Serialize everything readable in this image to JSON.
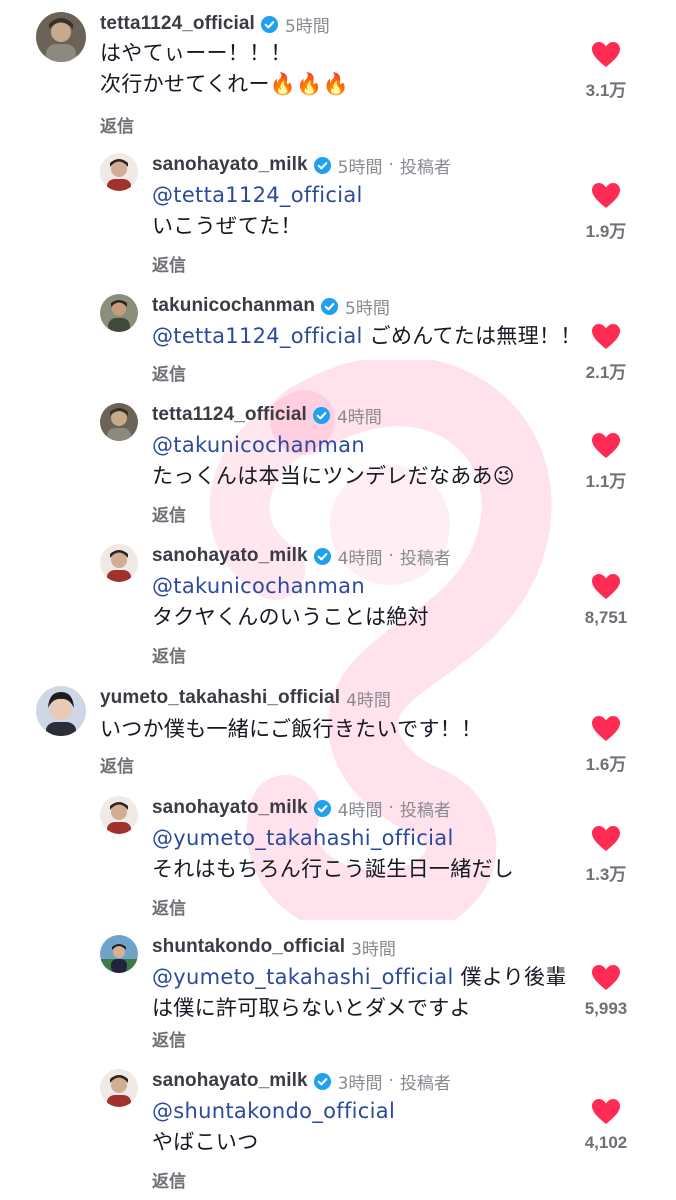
{
  "colors": {
    "mention": "#2b4a9e",
    "heart": "#fe2c55",
    "verified": "#20a0f0",
    "watermark": "#ff7aa8"
  },
  "icons": {
    "verified": "verified-badge-icon",
    "like": "heart-icon",
    "watermark": "app-logo-watermark"
  },
  "comments": [
    {
      "username": "tetta1124_official",
      "time": "5時間",
      "author": "",
      "mention": "",
      "line1": "はやてぃーー！！！",
      "line2": "次行かせてくれー🔥🔥🔥",
      "reply": "返信",
      "likes": "3.1万"
    },
    {
      "username": "sanohayato_milk",
      "time": "5時間",
      "sep": "·",
      "author": "投稿者",
      "mention": "@tetta1124_official",
      "line1": "",
      "line2": "いこうぜてた！",
      "reply": "返信",
      "likes": "1.9万"
    },
    {
      "username": "takunicochanman",
      "time": "5時間",
      "author": "",
      "mention": "@tetta1124_official",
      "line1": " ごめんてたは無理！！",
      "line2": "",
      "reply": "返信",
      "likes": "2.1万"
    },
    {
      "username": "tetta1124_official",
      "time": "4時間",
      "author": "",
      "mention": "@takunicochanman",
      "line1": "",
      "line2": "たっくんは本当にツンデレだなああ😉",
      "reply": "返信",
      "likes": "1.1万"
    },
    {
      "username": "sanohayato_milk",
      "time": "4時間",
      "sep": "·",
      "author": "投稿者",
      "mention": "@takunicochanman",
      "line1": "",
      "line2": "タクヤくんのいうことは絶対",
      "reply": "返信",
      "likes": "8,751"
    },
    {
      "username": "yumeto_takahashi_official",
      "time": "4時間",
      "author": "",
      "mention": "",
      "line1": "いつか僕も一緒にご飯行きたいです！！",
      "line2": "",
      "reply": "返信",
      "likes": "1.6万"
    },
    {
      "username": "sanohayato_milk",
      "time": "4時間",
      "sep": "·",
      "author": "投稿者",
      "mention": "@yumeto_takahashi_official",
      "line1": "",
      "line2": "それはもちろん行こう誕生日一緒だし",
      "reply": "返信",
      "likes": "1.3万"
    },
    {
      "username": "shuntakondo_official",
      "time": "3時間",
      "author": "",
      "mention": "@yumeto_takahashi_official",
      "line1": " 僕より後輩",
      "line2": "は僕に許可取らないとダメですよ",
      "reply": "返信",
      "likes": "5,993"
    },
    {
      "username": "sanohayato_milk",
      "time": "3時間",
      "sep": "·",
      "author": "投稿者",
      "mention": "@shuntakondo_official",
      "line1": "",
      "line2": "やばこいつ",
      "reply": "返信",
      "likes": "4,102"
    }
  ]
}
